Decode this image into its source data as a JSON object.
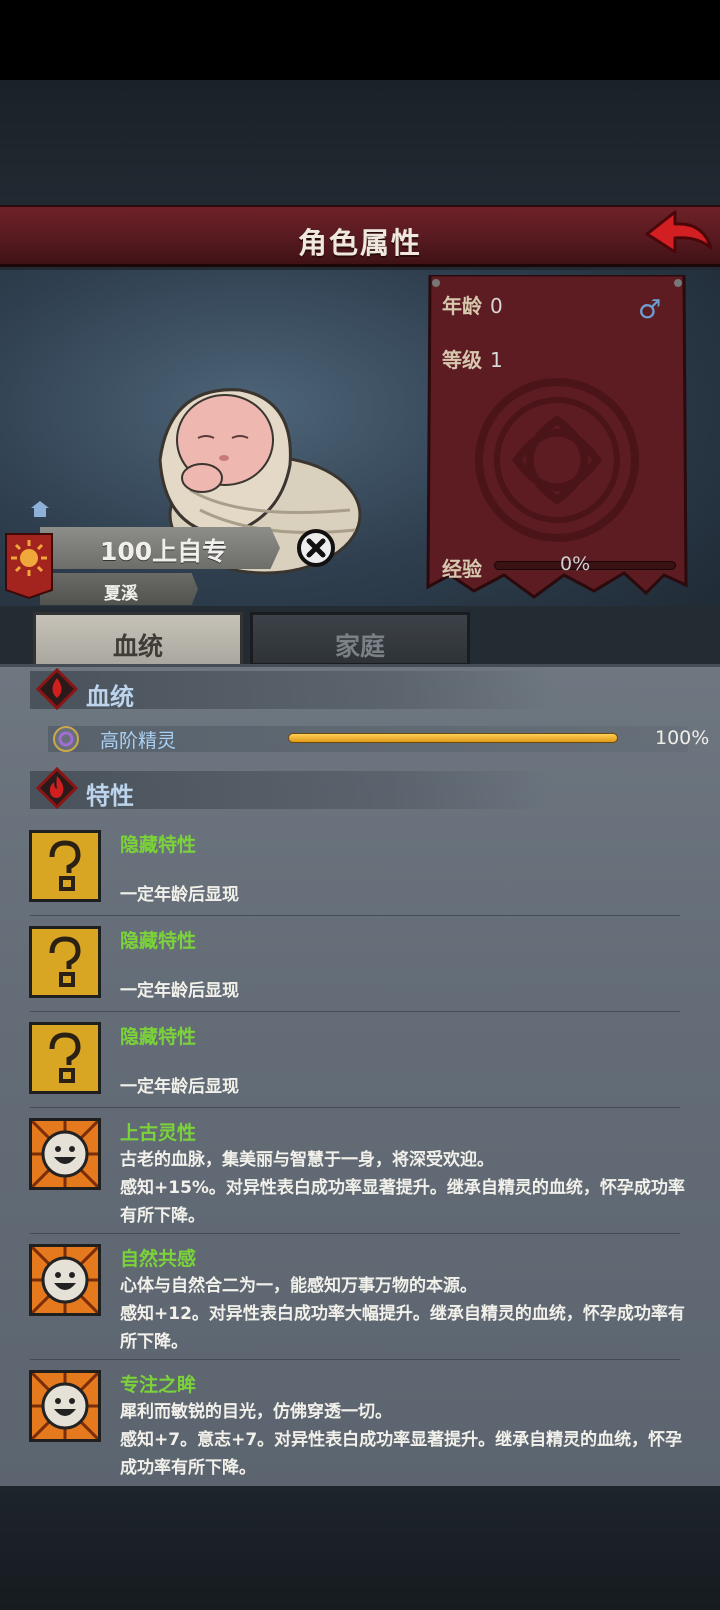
{
  "header": {
    "title": "角色属性"
  },
  "stats": {
    "age_label": "年龄",
    "age_value": "0",
    "level_label": "等级",
    "level_value": "1",
    "exp_label": "经验",
    "exp_value": "0%",
    "gender_icon": "male-icon"
  },
  "character": {
    "name": "100上自专",
    "subname": "夏溪"
  },
  "tabs": [
    {
      "label": "血统",
      "active": true
    },
    {
      "label": "家庭",
      "active": false
    }
  ],
  "bloodline": {
    "section_title": "血统",
    "entries": [
      {
        "name": "高阶精灵",
        "percent_text": "100%",
        "fill": 1.0
      }
    ]
  },
  "traits": {
    "section_title": "特性",
    "items": [
      {
        "icon": "question-icon",
        "name": "隐藏特性",
        "desc": "一定年龄后显现"
      },
      {
        "icon": "question-icon",
        "name": "隐藏特性",
        "desc": "一定年龄后显现"
      },
      {
        "icon": "question-icon",
        "name": "隐藏特性",
        "desc": "一定年龄后显现"
      },
      {
        "icon": "smiley-icon",
        "name": "上古灵性",
        "desc": "古老的血脉，集美丽与智慧于一身，将深受欢迎。\n感知+15%。对异性表白成功率显著提升。继承自精灵的血统，怀孕成功率有所下降。"
      },
      {
        "icon": "smiley-icon",
        "name": "自然共感",
        "desc": "心体与自然合二为一，能感知万事万物的本源。\n感知+12。对异性表白成功率大幅提升。继承自精灵的血统，怀孕成功率有所下降。"
      },
      {
        "icon": "smiley-icon",
        "name": "专注之眸",
        "desc": "犀利而敏锐的目光，仿佛穿透一切。\n感知+7。意志+7。对异性表白成功率显著提升。继承自精灵的血统，怀孕成功率有所下降。"
      }
    ]
  },
  "colors": {
    "accent_red": "#6e2128",
    "trait_green": "#7bd23a",
    "bloodline_blue": "#a9d0f2",
    "bar_gold": "#f0b232"
  }
}
